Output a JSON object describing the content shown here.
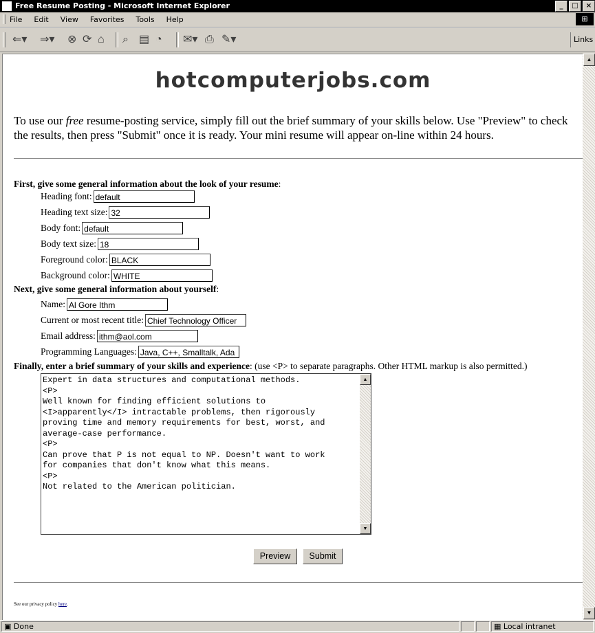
{
  "window": {
    "title": "Free Resume Posting - Microsoft Internet Explorer",
    "buttons": [
      "_",
      "□",
      "×"
    ]
  },
  "menubar": {
    "items": [
      "File",
      "Edit",
      "View",
      "Favorites",
      "Tools",
      "Help"
    ]
  },
  "toolbar": {
    "links_label": "Links"
  },
  "page": {
    "site_heading": "hotcomputerjobs.com",
    "intro_before": "To use our ",
    "intro_em": "free",
    "intro_after": " resume-posting service, simply fill out the brief summary of your skills below. Use \"Preview\" to check the results, then press \"Submit\" once it is ready. Your mini resume will appear on-line within 24 hours.",
    "section1": "First, give some general information about the look of your resume",
    "section2": "Next, give some general information about yourself",
    "section3_bold": "Finally, enter a brief summary of your skills and experience",
    "section3_note": " (use <P> to separate paragraphs. Other HTML markup is also permitted.)",
    "look_fields": [
      {
        "label": "Heading font:",
        "value": "default"
      },
      {
        "label": "Heading text size:",
        "value": "32"
      },
      {
        "label": "Body font:",
        "value": "default"
      },
      {
        "label": "Body text size:",
        "value": "18"
      },
      {
        "label": "Foreground color:",
        "value": "BLACK"
      },
      {
        "label": "Background color:",
        "value": "WHITE"
      }
    ],
    "personal_fields": [
      {
        "label": "Name:",
        "value": "Al Gore Ithm"
      },
      {
        "label": "Current or most recent title:",
        "value": "Chief Technology Officer"
      },
      {
        "label": "Email address:",
        "value": "ithm@aol.com"
      },
      {
        "label": "Programming Languages:",
        "value": "Java, C++, Smalltalk, Ada"
      }
    ],
    "summary_text": "Expert in data structures and computational methods.\n<P>\nWell known for finding efficient solutions to\n<I>apparently</I> intractable problems, then rigorously\nproving time and memory requirements for best, worst, and\naverage-case performance.\n<P>\nCan prove that P is not equal to NP. Doesn't want to work\nfor companies that don't know what this means.\n<P>\nNot related to the American politician.",
    "preview_label": "Preview",
    "submit_label": "Submit",
    "privacy_text": "See our privacy policy ",
    "privacy_link": "here",
    "privacy_end": "."
  },
  "statusbar": {
    "text": "Done",
    "zone": "Local intranet"
  }
}
